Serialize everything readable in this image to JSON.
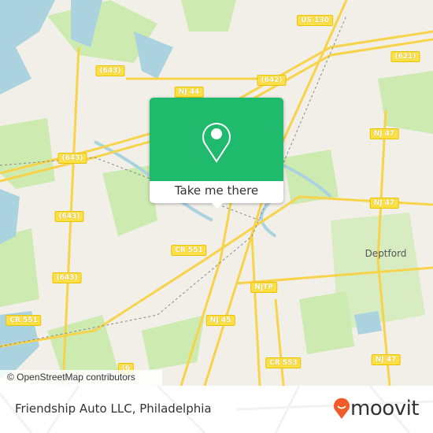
{
  "map": {
    "labels": {
      "us130": "US 130",
      "r621": "(621)",
      "r643a": "(643)",
      "r642": "(642)",
      "nj44": "NJ 44",
      "nj47a": "NJ 47",
      "r643b": "(643)",
      "nj47b": "NJ 47",
      "r643c": "(643)",
      "cr551a": "CR 551",
      "r643d": "(643)",
      "njtp": "NJTP",
      "cr551b": "CR 551",
      "nj45": "NJ 45",
      "cr553": "CR 553",
      "nj47c": "NJ 47",
      "r6x": "(6"
    },
    "place": "Deptford",
    "attribution": "© OpenStreetMap contributors",
    "colors": {
      "water": "#aad3df",
      "park": "#cdebb0",
      "road": "#fde047",
      "popup": "#1fba6b"
    }
  },
  "popup": {
    "button_label": "Take me there",
    "icon": "map-pin-icon"
  },
  "footer": {
    "title": "Friendship Auto LLC, Philadelphia",
    "logo_text": "moovit",
    "logo_color": "#f15a29"
  }
}
